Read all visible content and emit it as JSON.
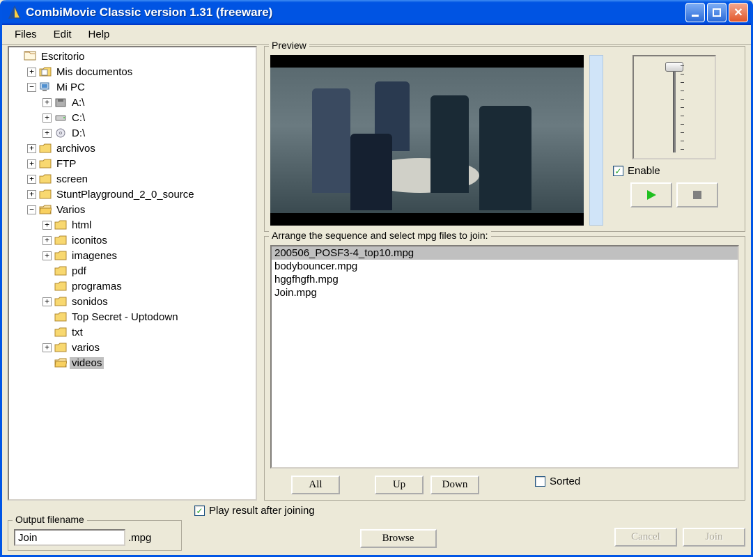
{
  "window": {
    "title": "CombiMovie Classic version 1.31 (freeware)"
  },
  "menu": {
    "files": "Files",
    "edit": "Edit",
    "help": "Help"
  },
  "tree": {
    "root": "Escritorio",
    "mis_documentos": "Mis documentos",
    "mi_pc": "Mi PC",
    "a_drive": "A:\\",
    "c_drive": "C:\\",
    "d_drive": "D:\\",
    "archivos": "archivos",
    "ftp": "FTP",
    "screen": "screen",
    "stunt": "StuntPlayground_2_0_source",
    "varios": "Varios",
    "html": "html",
    "iconitos": "iconitos",
    "imagenes": "imagenes",
    "pdf": "pdf",
    "programas": "programas",
    "sonidos": "sonidos",
    "top_secret": "Top Secret - Uptodown",
    "txt": "txt",
    "varios2": "varios",
    "videos": "videos"
  },
  "preview": {
    "label": "Preview",
    "enable": "Enable",
    "enable_checked": "✓"
  },
  "arrange": {
    "label": "Arrange the sequence and select mpg files to join:",
    "files": [
      "200506_POSF3-4_top10.mpg",
      "bodybouncer.mpg",
      "hggfhgfh.mpg",
      "Join.mpg"
    ],
    "all": "All",
    "up": "Up",
    "down": "Down",
    "sorted": "Sorted"
  },
  "output": {
    "label": "Output filename",
    "value": "Join",
    "ext": ".mpg"
  },
  "options": {
    "play_result": "Play result after joining",
    "play_result_checked": "✓"
  },
  "buttons": {
    "browse": "Browse",
    "cancel": "Cancel",
    "join": "Join"
  }
}
